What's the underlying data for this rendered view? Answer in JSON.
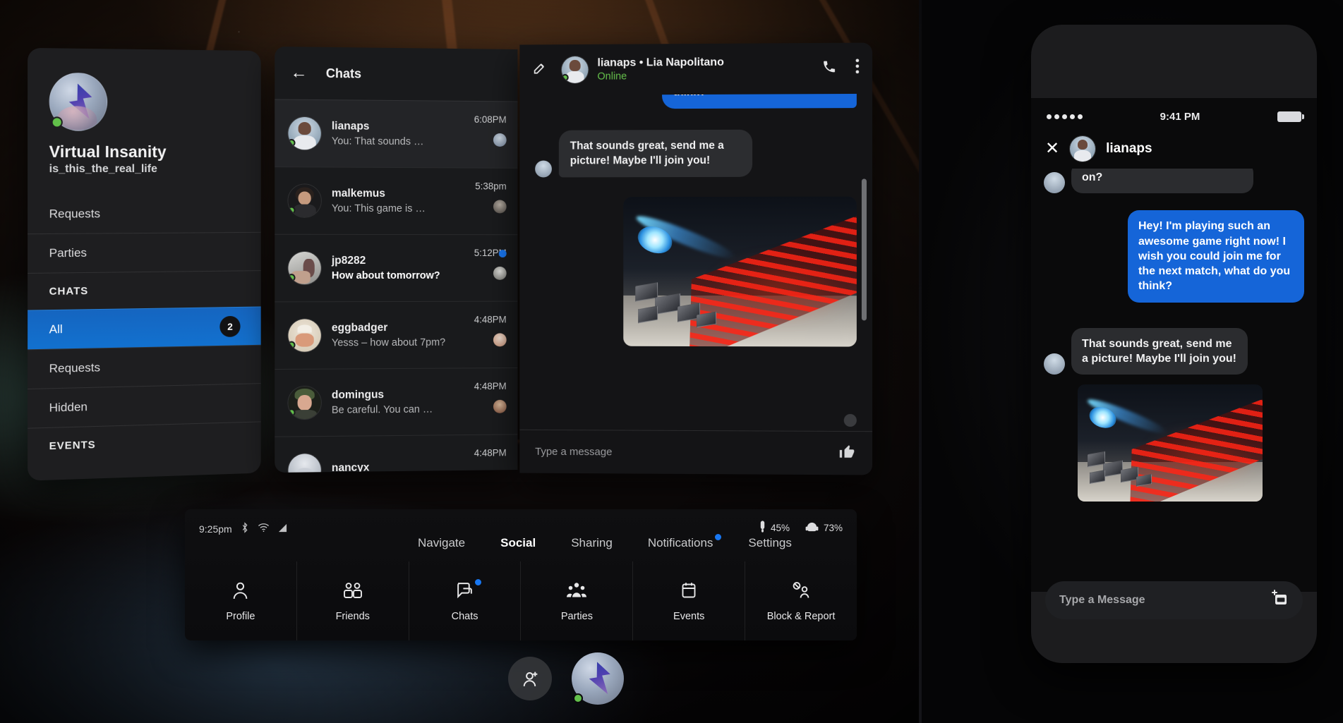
{
  "nav_panel": {
    "profile": {
      "display_name": "Virtual Insanity",
      "username": "is_this_the_real_life",
      "status": "online"
    },
    "items": [
      {
        "label": "Requests",
        "type": "link",
        "badge": ""
      },
      {
        "label": "Parties",
        "type": "link",
        "badge": ""
      },
      {
        "label": "CHATS",
        "type": "section",
        "badge": ""
      },
      {
        "label": "All",
        "type": "link",
        "badge": "2",
        "active": true
      },
      {
        "label": "Requests",
        "type": "link",
        "badge": ""
      },
      {
        "label": "Hidden",
        "type": "link",
        "badge": ""
      },
      {
        "label": "EVENTS",
        "type": "section",
        "badge": ""
      }
    ]
  },
  "chat_list": {
    "title": "Chats",
    "back_icon": "back-arrow-icon",
    "rows": [
      {
        "name": "lianaps",
        "preview": "You: That sounds …",
        "time": "6:08PM",
        "unread": false,
        "selected": true,
        "online": true
      },
      {
        "name": "malkemus",
        "preview": "You: This game is …",
        "time": "5:38pm",
        "unread": false,
        "selected": false,
        "online": true
      },
      {
        "name": "jp8282",
        "preview": "How about tomorrow?",
        "time": "5:12PM",
        "unread": true,
        "selected": false,
        "online": true
      },
      {
        "name": "eggbadger",
        "preview": "Yesss – how about 7pm?",
        "time": "4:48PM",
        "unread": false,
        "selected": false,
        "online": true
      },
      {
        "name": "domingus",
        "preview": "Be careful. You can …",
        "time": "4:48PM",
        "unread": false,
        "selected": false,
        "online": true
      },
      {
        "name": "nancyx",
        "preview": "",
        "time": "4:48PM",
        "unread": false,
        "selected": false,
        "online": false
      }
    ]
  },
  "conversation": {
    "compose_icon": "compose-icon",
    "title": "lianaps • Lia Napolitano",
    "status": "Online",
    "call_icon": "phone-icon",
    "more_icon": "more-vertical-icon",
    "messages": [
      {
        "from": "me",
        "text": "think?"
      },
      {
        "from": "them",
        "text": "That sounds great, send me a picture! Maybe I'll join you!"
      },
      {
        "from": "me",
        "text": "",
        "type": "image",
        "alt": "game-screenshot"
      }
    ],
    "input_placeholder": "Type a message",
    "like_icon": "thumbs-up-icon"
  },
  "taskbar": {
    "clock": "9:25pm",
    "system_icons": [
      "bluetooth-icon",
      "wifi-icon",
      "signal-icon"
    ],
    "right_status": [
      {
        "icon": "controller-battery-icon",
        "value": "45%"
      },
      {
        "icon": "headset-battery-icon",
        "value": "73%"
      }
    ],
    "tabs": [
      {
        "label": "Navigate",
        "active": false,
        "notif": false
      },
      {
        "label": "Social",
        "active": true,
        "notif": false
      },
      {
        "label": "Sharing",
        "active": false,
        "notif": false
      },
      {
        "label": "Notifications",
        "active": false,
        "notif": true
      },
      {
        "label": "Settings",
        "active": false,
        "notif": false
      }
    ],
    "items": [
      {
        "label": "Profile",
        "icon": "person-icon",
        "notif": false
      },
      {
        "label": "Friends",
        "icon": "friends-icon",
        "notif": false
      },
      {
        "label": "Chats",
        "icon": "chat-icon",
        "notif": true
      },
      {
        "label": "Parties",
        "icon": "parties-icon",
        "notif": false
      },
      {
        "label": "Events",
        "icon": "calendar-icon",
        "notif": false
      },
      {
        "label": "Block & Report",
        "icon": "block-report-icon",
        "notif": false
      }
    ]
  },
  "dock": {
    "add_friend_icon": "add-person-icon",
    "avatar_label": "user-avatar",
    "avatar_status": "online"
  },
  "phone": {
    "status_time": "9:41 PM",
    "signal_icon": "signal-dots-icon",
    "battery_icon": "battery-icon",
    "close_icon": "close-icon",
    "contact": "lianaps",
    "messages": [
      {
        "from": "them",
        "text": "on?"
      },
      {
        "from": "me",
        "text": "Hey! I'm playing such an awesome game right now! I wish you could join me for the next match, what do you think?"
      },
      {
        "from": "them",
        "text": "That sounds great, send me a picture! Maybe I'll join you!"
      },
      {
        "from": "them",
        "text": "",
        "type": "image",
        "alt": "game-screenshot"
      }
    ],
    "input_placeholder": "Type a Message",
    "attach_icon": "add-media-icon"
  },
  "colors": {
    "accent_blue": "#1565d8",
    "nav_active": "#1565c0",
    "online_green": "#62c04a",
    "notif_blue": "#1877f2",
    "panel_bg": "#1b1b1d"
  }
}
